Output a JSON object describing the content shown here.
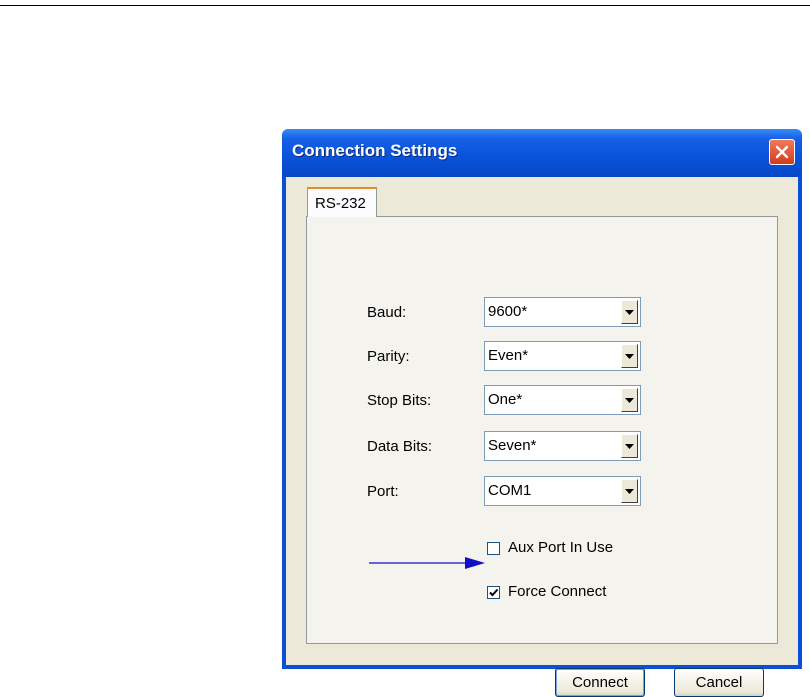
{
  "window": {
    "title": "Connection Settings"
  },
  "tabs": [
    {
      "label": "RS-232"
    }
  ],
  "fields": [
    {
      "label": "Baud:",
      "value": "9600*"
    },
    {
      "label": "Parity:",
      "value": "Even*"
    },
    {
      "label": "Stop Bits:",
      "value": "One*"
    },
    {
      "label": "Data Bits:",
      "value": "Seven*"
    },
    {
      "label": "Port:",
      "value": "COM1"
    }
  ],
  "checkboxes": [
    {
      "label": "Aux Port In Use",
      "checked": false
    },
    {
      "label": "Force Connect",
      "checked": true
    }
  ],
  "buttons": {
    "connect": "Connect",
    "cancel": "Cancel"
  },
  "annotation": {
    "arrow_color": "#1010c8",
    "target": "Force Connect"
  },
  "colors": {
    "titlebar": "#0a52d8",
    "client": "#ece9d8"
  }
}
